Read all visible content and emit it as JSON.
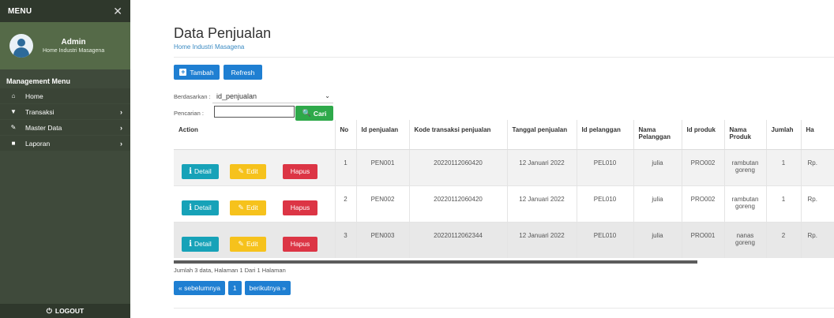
{
  "sidebar": {
    "menu_title": "MENU",
    "close_glyph": "✕",
    "user": {
      "name": "Admin",
      "subtitle": "Home Industri Masagena"
    },
    "section_title": "Management Menu",
    "items": [
      {
        "label": "Home",
        "icon": "home-icon",
        "glyph": "⌂",
        "has_chevron": false
      },
      {
        "label": "Transaksi",
        "icon": "cart-icon",
        "glyph": "▼",
        "has_chevron": true
      },
      {
        "label": "Master Data",
        "icon": "edit-icon",
        "glyph": "✎",
        "has_chevron": true
      },
      {
        "label": "Laporan",
        "icon": "briefcase-icon",
        "glyph": "■",
        "has_chevron": true
      }
    ],
    "chevron": "›",
    "logout": "LOGOUT",
    "logout_glyph": "⏻",
    "colors": {
      "bg": "#3f4a3b",
      "header": "#2f382c",
      "user_panel": "#556a48"
    }
  },
  "header": {
    "title": "Data Penjualan",
    "subtitle": "Home Industri Masagena"
  },
  "toolbar": {
    "tambah_label": "Tambah",
    "tambah_icon": "+",
    "refresh_label": "Refresh"
  },
  "filter": {
    "berdasarkan_label": "Berdasarkan :",
    "selected_value": "id_penjualan",
    "caret": "⌄",
    "pencarian_label": "Pencarian :",
    "search_value": "",
    "cari_label": "Cari",
    "cari_icon": "🔍"
  },
  "table": {
    "headers": [
      "Action",
      "No",
      "Id penjualan",
      "Kode transaksi penjualan",
      "Tanggal penjualan",
      "Id pelanggan",
      "Nama Pelanggan",
      "Id produk",
      "Nama Produk",
      "Jumlah",
      "Ha"
    ],
    "action_labels": {
      "detail": "Detail",
      "detail_icon": "i",
      "edit": "Edit",
      "edit_icon": "✎",
      "hapus": "Hapus"
    },
    "rows": [
      {
        "no": "1",
        "id_penjualan": "PEN001",
        "kode": "20220112060420",
        "tanggal": "12 Januari 2022",
        "id_pelanggan": "PEL010",
        "nama_pelanggan": "julia",
        "id_produk": "PRO002",
        "nama_produk": "rambutan goreng",
        "jumlah": "1",
        "harga": "Rp."
      },
      {
        "no": "2",
        "id_penjualan": "PEN002",
        "kode": "20220112060420",
        "tanggal": "12 Januari 2022",
        "id_pelanggan": "PEL010",
        "nama_pelanggan": "julia",
        "id_produk": "PRO002",
        "nama_produk": "rambutan goreng",
        "jumlah": "1",
        "harga": "Rp."
      },
      {
        "no": "3",
        "id_penjualan": "PEN003",
        "kode": "20220112062344",
        "tanggal": "12 Januari 2022",
        "id_pelanggan": "PEL010",
        "nama_pelanggan": "julia",
        "id_produk": "PRO001",
        "nama_produk": "nanas goreng",
        "jumlah": "2",
        "harga": "Rp."
      }
    ]
  },
  "pagination": {
    "info": "Jumlah 3 data, Halaman 1 Dari 1 Halaman",
    "prev_label": "« sebelumnya",
    "current_page": "1",
    "next_label": "berikutnya »"
  },
  "colors": {
    "primary": "#1f7fd2",
    "success": "#2ea94a",
    "info": "#17a2b8",
    "warning": "#f6c21c",
    "danger": "#dc3545"
  }
}
